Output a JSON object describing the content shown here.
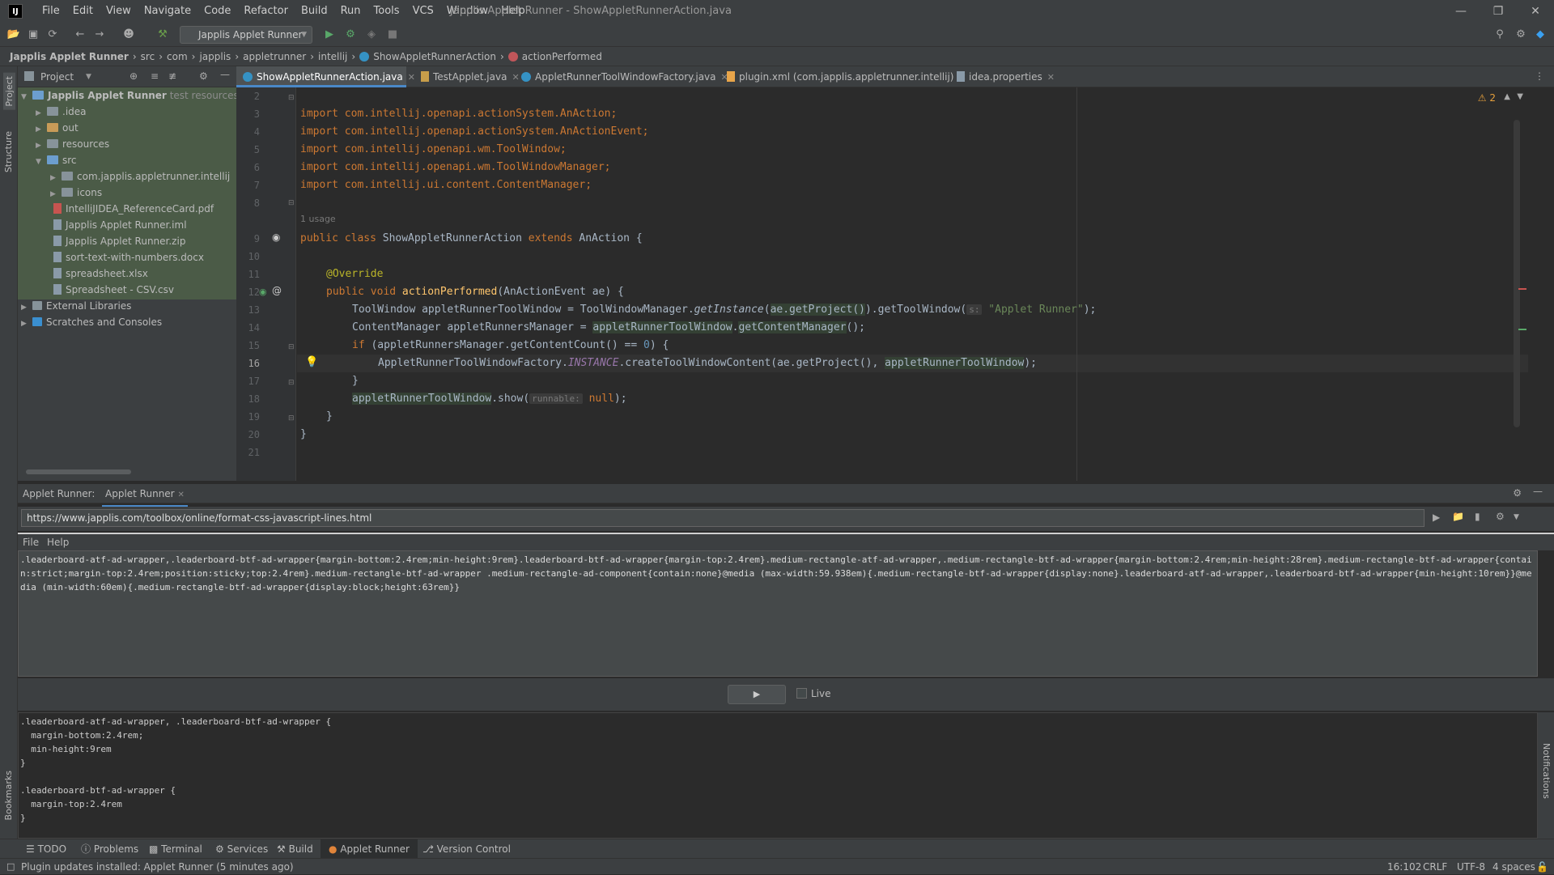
{
  "window": {
    "title": "Japplis Applet Runner - ShowAppletRunnerAction.java",
    "menus": [
      "File",
      "Edit",
      "View",
      "Navigate",
      "Code",
      "Refactor",
      "Build",
      "Run",
      "Tools",
      "VCS",
      "Window",
      "Help"
    ]
  },
  "toolbar": {
    "run_config": "Japplis Applet Runner"
  },
  "breadcrumb": [
    "Japplis Applet Runner",
    "src",
    "com",
    "japplis",
    "appletrunner",
    "intellij",
    "ShowAppletRunnerAction",
    "actionPerformed"
  ],
  "left_strip": {
    "project": "Project",
    "structure": "Structure",
    "bookmarks": "Bookmarks"
  },
  "right_strip": {
    "notifications": "Notifications"
  },
  "project_panel": {
    "title": "Project",
    "root": {
      "name": "Japplis Applet Runner",
      "hint": "test resources root,"
    },
    "items": [
      {
        "name": ".idea",
        "type": "folder"
      },
      {
        "name": "out",
        "type": "folder"
      },
      {
        "name": "resources",
        "type": "folder"
      },
      {
        "name": "src",
        "type": "folder"
      },
      {
        "name": "com.japplis.appletrunner.intellij",
        "type": "folder"
      },
      {
        "name": "icons",
        "type": "folder"
      },
      {
        "name": "IntelliJIDEA_ReferenceCard.pdf",
        "type": "file"
      },
      {
        "name": "Japplis Applet Runner.iml",
        "type": "file"
      },
      {
        "name": "Japplis Applet Runner.zip",
        "type": "file"
      },
      {
        "name": "sort-text-with-numbers.docx",
        "type": "file"
      },
      {
        "name": "spreadsheet.xlsx",
        "type": "file"
      },
      {
        "name": "Spreadsheet - CSV.csv",
        "type": "file"
      },
      {
        "name": "External Libraries",
        "type": "lib"
      },
      {
        "name": "Scratches and Consoles",
        "type": "scratch"
      }
    ]
  },
  "editor_tabs": [
    {
      "label": "ShowAppletRunnerAction.java",
      "active": true
    },
    {
      "label": "TestApplet.java",
      "active": false
    },
    {
      "label": "AppletRunnerToolWindowFactory.java",
      "active": false
    },
    {
      "label": "plugin.xml (com.japplis.appletrunner.intellij)",
      "active": false
    },
    {
      "label": "idea.properties",
      "active": false
    }
  ],
  "editor": {
    "warnings": "2",
    "line_numbers": [
      "2",
      "3",
      "4",
      "5",
      "6",
      "7",
      "8",
      "",
      "9",
      "10",
      "11",
      "12",
      "13",
      "14",
      "15",
      "16",
      "17",
      "18",
      "19",
      "20",
      "21"
    ],
    "usage_hint": "1 usage",
    "param_hint_title": "s:",
    "param_hint_runnable": "runnable:",
    "code": {
      "l3": "import com.intellij.openapi.actionSystem.AnAction;",
      "l4": "import com.intellij.openapi.actionSystem.AnActionEvent;",
      "l5": "import com.intellij.openapi.wm.ToolWindow;",
      "l6": "import com.intellij.openapi.wm.ToolWindowManager;",
      "l7": "import com.intellij.ui.content.ContentManager;",
      "l9a": "public class ",
      "l9b": "ShowAppletRunnerAction ",
      "l9c": "extends ",
      "l9d": "AnAction {",
      "l11": "@Override",
      "l12a": "public void ",
      "l12b": "actionPerformed",
      "l12c": "(AnActionEvent ae) {",
      "l13a": "ToolWindow ",
      "l13b": "appletRunnerToolWindow",
      "l13c": " = ToolWindowManager.",
      "l13d": "getInstance",
      "l13e": "(",
      "l13f": "ae.getProject()",
      "l13g": ").getToolWindow(",
      "l13h": "\"Applet Runner\"",
      "l13i": ");",
      "l14a": "ContentManager appletRunnersManager = ",
      "l14b": "appletRunnerToolWindow",
      "l14c": ".",
      "l14d": "getContentManager",
      "l14e": "();",
      "l15a": "if ",
      "l15b": "(appletRunnersManager.getContentCount() == ",
      "l15c": "0",
      "l15d": ") {",
      "l16a": "AppletRunnerToolWindowFactory.",
      "l16b": "INSTANCE",
      "l16c": ".createToolWindowContent(ae.getProject(), ",
      "l16d": "appletRunnerToolWindow",
      "l16e": ");",
      "l17": "}",
      "l18a": "appletRunnerToolWindow",
      "l18b": ".show(",
      "l18c": "null",
      "l18d": ");",
      "l19": "}",
      "l20": "}"
    }
  },
  "applet_panel": {
    "label": "Applet Runner:",
    "tab": "Applet Runner",
    "url": "https://www.japplis.com/toolbox/online/format-css-javascript-lines.html",
    "menus": [
      "File",
      "Help"
    ],
    "input_text": ".leaderboard-atf-ad-wrapper,.leaderboard-btf-ad-wrapper{margin-bottom:2.4rem;min-height:9rem}.leaderboard-btf-ad-wrapper{margin-top:2.4rem}.medium-rectangle-atf-ad-wrapper,.medium-rectangle-btf-ad-wrapper{margin-bottom:2.4rem;min-height:28rem}.medium-rectangle-btf-ad-wrapper{contain:strict;margin-top:2.4rem;position:sticky;top:2.4rem}.medium-rectangle-btf-ad-wrapper .medium-rectangle-ad-component{contain:none}@media (max-width:59.938em){.medium-rectangle-btf-ad-wrapper{display:none}.leaderboard-atf-ad-wrapper,.leaderboard-btf-ad-wrapper{min-height:10rem}}@media (min-width:60em){.medium-rectangle-btf-ad-wrapper{display:block;height:63rem}}",
    "live_label": "Live",
    "output_text": ".leaderboard-atf-ad-wrapper, .leaderboard-btf-ad-wrapper {\n  margin-bottom:2.4rem;\n  min-height:9rem\n}\n\n.leaderboard-btf-ad-wrapper {\n  margin-top:2.4rem\n}"
  },
  "bottom_tabs": [
    "TODO",
    "Problems",
    "Terminal",
    "Services",
    "Build",
    "Applet Runner",
    "Version Control"
  ],
  "status": {
    "message": "Plugin updates installed: Applet Runner (5 minutes ago)",
    "position": "16:102",
    "line_sep": "CRLF",
    "encoding": "UTF-8",
    "indent": "4 spaces"
  },
  "colors": {
    "accent": "#4a88c7",
    "keyword": "#cc7832",
    "string": "#6a8759",
    "annotation": "#bbb529"
  }
}
